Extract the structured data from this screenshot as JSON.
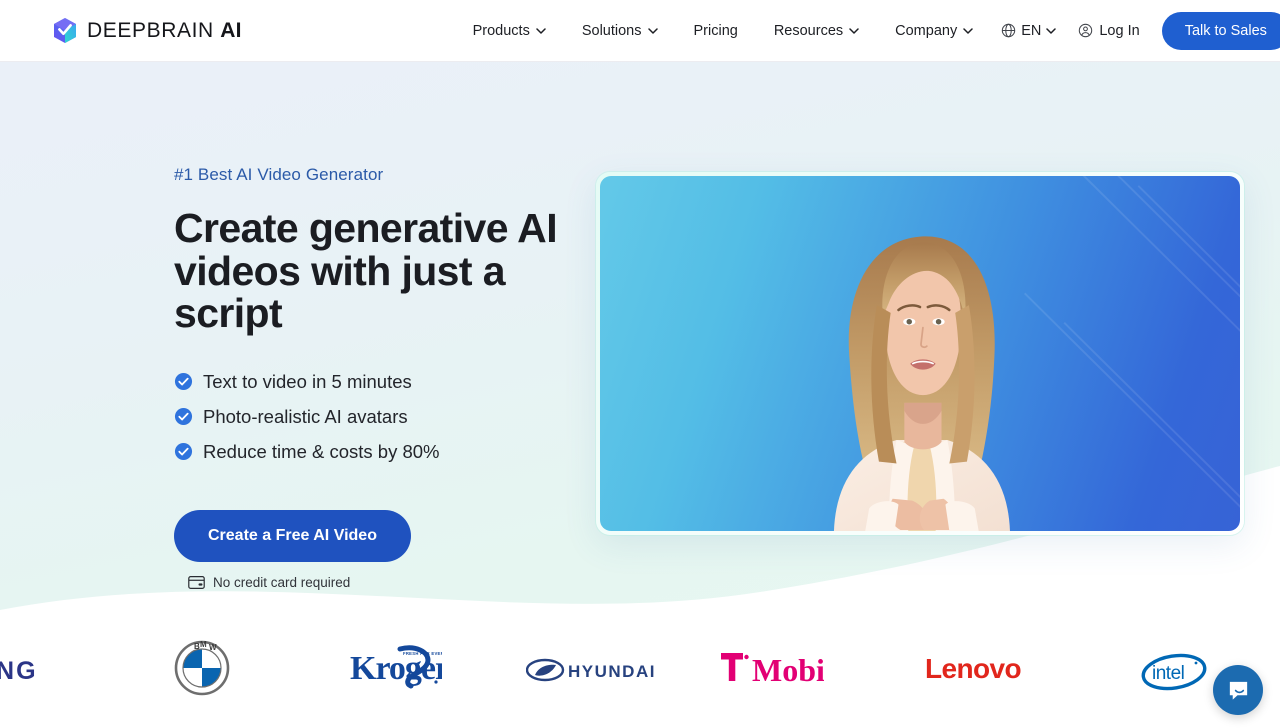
{
  "header": {
    "brand": {
      "name_light": "DEEPBRAIN",
      "name_bold": "AI",
      "logo_icon": "deepbrain-cube-icon"
    },
    "nav": [
      {
        "label": "Products",
        "has_dropdown": true
      },
      {
        "label": "Solutions",
        "has_dropdown": true
      },
      {
        "label": "Pricing",
        "has_dropdown": false
      },
      {
        "label": "Resources",
        "has_dropdown": true
      },
      {
        "label": "Company",
        "has_dropdown": true
      }
    ],
    "language": {
      "label": "EN",
      "icon": "globe-icon"
    },
    "login": {
      "label": "Log In",
      "icon": "account-circle-icon"
    },
    "cta": {
      "label": "Talk to Sales",
      "color": "#1f5fd0"
    }
  },
  "hero": {
    "eyebrow": "#1 Best AI Video Generator",
    "headline": "Create generative AI\nvideos with just a script",
    "bullets": [
      {
        "text": "Text to video in 5 minutes",
        "icon": "check-circle-icon"
      },
      {
        "text": "Photo-realistic AI avatars",
        "icon": "check-circle-icon"
      },
      {
        "text": "Reduce time & costs by 80%",
        "icon": "check-circle-icon"
      }
    ],
    "cta": {
      "label": "Create a Free AI Video",
      "color": "#1f52bf"
    },
    "note": {
      "text": "No credit card required",
      "icon": "credit-card-icon"
    },
    "media": {
      "type": "ai-avatar-video",
      "alt": "AI generated female presenter in a cream blazer on a blue gradient background"
    }
  },
  "logos": {
    "items": [
      {
        "name": "Samsung",
        "icon": "samsung-logo",
        "color": "#2b3587",
        "truncated": true,
        "visible_text": "SUNG"
      },
      {
        "name": "BMW",
        "icon": "bmw-logo",
        "color": "#0066b1"
      },
      {
        "name": "Kroger",
        "icon": "kroger-logo",
        "color": "#14489b",
        "tagline": "FRESH FOR EVERYONE ™"
      },
      {
        "name": "Hyundai",
        "icon": "hyundai-logo",
        "color": "#27427f",
        "visible_text": "HYUNDAI"
      },
      {
        "name": "T-Mobile",
        "icon": "tmobile-logo",
        "color": "#e20074",
        "visible_text": "T Mobile"
      },
      {
        "name": "Lenovo",
        "icon": "lenovo-logo",
        "color": "#e1261c",
        "visible_text": "Lenovo"
      },
      {
        "name": "Intel",
        "icon": "intel-logo",
        "color": "#0068b5",
        "visible_text": "intel"
      }
    ]
  },
  "chat_widget": {
    "icon": "chat-bubble-icon",
    "color": "#1c6bb0",
    "label": "Open chat"
  }
}
